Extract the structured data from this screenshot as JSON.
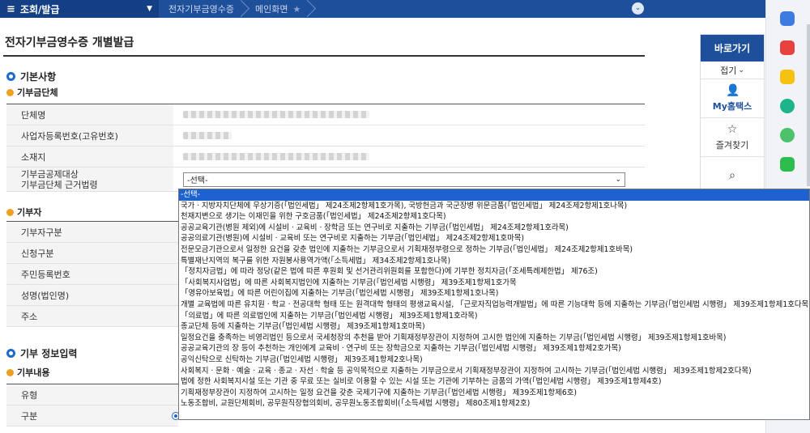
{
  "topbar": {
    "menu_label": "조회/발급",
    "crumbs": [
      "전자기부금영수증",
      "메인화면"
    ]
  },
  "page": {
    "title": "전자기부금영수증 개별발급"
  },
  "section_basic": {
    "title": "기본사항",
    "org_subtitle": "기부금단체",
    "org_rows": [
      {
        "label": "단체명"
      },
      {
        "label": "사업자등록번호(고유번호)"
      },
      {
        "label": "소재지"
      },
      {
        "label_line1": "기부금공제대상",
        "label_line2": "기부금단체 근거법령",
        "select_value": "-선택-"
      }
    ],
    "donor_subtitle": "기부자",
    "donor_rows": [
      {
        "label": "기부자구분"
      },
      {
        "label": "신청구분"
      },
      {
        "label": "주민등록번호"
      },
      {
        "label": "성명(법인명)"
      },
      {
        "label": "주소"
      }
    ]
  },
  "section_donation": {
    "title": "기부 정보입력",
    "subtitle": "기부내용",
    "rows": [
      {
        "label": "유형"
      },
      {
        "label": "구분"
      }
    ]
  },
  "quick_panel": {
    "title": "바로가기",
    "fold_label": "접기",
    "items": [
      {
        "label": "My홈택스",
        "icon": "person-icon"
      },
      {
        "label": "즐겨찾기",
        "icon": "star-icon"
      }
    ]
  },
  "dropdown": {
    "options": [
      "-선택-",
      "국가ㆍ지방자치단체에 무상기증(「법인세법」 제24조제2항제1호가목), 국방헌금과 국군장병 위문금품(「법인세법」 제24조제2항제1호나목)",
      "천재지변으로 생기는 이재민을 위한 구호금품(「법인세법」 제24조제2항제1호다목)",
      "공공교육기관(병원 제외)에 시설비ㆍ교육비ㆍ장학금 또는 연구비로 지출하는 기부금(「법인세법」 제24조제2항제1호라목)",
      "공공의료기관(병원)에 시설비ㆍ교육비 또는 연구비로 지출하는 기부금(「법인세법」 제24조제2항제1호마목)",
      "전문모금기관으로서 일정한 요건을 갖춘 법인에 지출하는 기부금으로서 기획재정부령으로 정하는 기부금(「법인세법」 제24조제2항제1호바목)",
      "특별재난지역의 복구를 위한 자원봉사용역가액(「소득세법」 제34조제2항제1호나목)",
      "「정치자금법」에 따라 정당(같은 법에 따른 후원회 및 선거관리위원회를 포함한다)에 기부한 정치자금(「조세특례제한법」 제76조)",
      "「사회복지사업법」에 따른 사회복지법인에 지출하는 기부금(「법인세법 시행령」 제39조제1항제1호가목",
      "「영유아보육법」에 따른 어린이집에 지출하는 기부금(「법인세법 시행령」 제39조제1항제1호나목)",
      "개별 교육법에 따른 유치원ㆍ학교ㆍ전공대학 형태 또는 원격대학 형태의 평생교육시설, 「근로자직업능력개발법」에 따른 기능대학 등에 지출하는 기부금(「법인세법 시행령」 제39조제1항제1호다목)",
      "「의료법」에 따른 의료법인에 지출하는 기부금(「법인세법 시행령」 제39조제1항제1호라목)",
      "종교단체 등에 지출하는 기부금(「법인세법 시행령」 제39조제1항제1호마목)",
      "일정요건을 충족하는 비영리법인 등으로서 국세청장의 추천을 받아 기획재정부장관이 지정하여 고시한 법인에 지출하는 기부금(「법인세법 시행령」 제39조제1항제1호바목)",
      "공공교육기관의 장 등이 추천하는 개인에게 교육비ㆍ연구비 또는 장학금으로 지출하는 기부금(「법인세법 시행령」 제39조제1항제2호가목)",
      "공익신탁으로 신탁하는 기부금(「법인세법 시행령」 제39조제1항제2호나목)",
      "사회복지ㆍ문화ㆍ예술ㆍ교육ㆍ종교ㆍ자선ㆍ학술 등 공익목적으로 지출하는 기부금으로서 기획재정부장관이 지정하여 고시하는 기부금(「법인세법 시행령」 제39조제1항제2호다목)",
      "법에 정한 사회복지시설 또는 기관 중 무료 또는 실비로 이용할 수 있는 시설 또는 기관에 기부하는 금품의 가액(「법인세법 시행령」 제39조제1항제4호)",
      "기획재정부장관이 지정하여 고시하는 일정 요건을 갖춘 국제기구에 지출하는 기부금(「법인세법 시행령」 제39조제1항제6호)",
      "노동조합비, 교원단체회비, 공무원직장협의회비, 공무원노동조합회비(「소득세법 시행령」 제80조제1항제2호)"
    ]
  }
}
